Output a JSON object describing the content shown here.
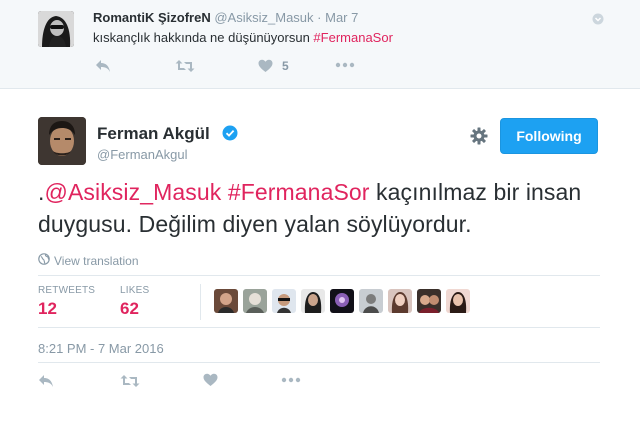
{
  "reply_tweet": {
    "name": "RomantiK ŞizofreN",
    "handle": "@Asiksiz_Masuk",
    "separator": "·",
    "date": "Mar 7",
    "text_prefix": "kıskançlık hakkında ne düşünüyorsun ",
    "hashtag": "#FermanaSor",
    "likes_count": "5"
  },
  "main_tweet": {
    "name": "Ferman Akgül",
    "handle": "@FermanAkgul",
    "follow_label": "Following",
    "text_dot": ".",
    "mention": "@Asiksiz_Masuk",
    "space": " ",
    "hashtag": "#FermanaSor",
    "text_rest": " kaçınılmaz bir insan duygusu. Değilim diyen yalan söylüyordur.",
    "view_translation": "View translation",
    "stats": {
      "retweets_label": "RETWEETS",
      "retweets_value": "12",
      "likes_label": "LIKES",
      "likes_value": "62"
    },
    "timestamp": "8:21 PM - 7 Mar 2016"
  },
  "icons": [
    "reply-icon",
    "retweet-icon",
    "heart-icon",
    "more-icon",
    "gear-icon",
    "verified-icon",
    "globe-icon",
    "caret-down-icon"
  ],
  "colors": {
    "accent": "#1da1f2",
    "hashtag": "#e0245e",
    "muted": "#8899a6",
    "icon": "#aab8c2",
    "text": "#292f33",
    "reply_bg": "#f5f8fa"
  }
}
